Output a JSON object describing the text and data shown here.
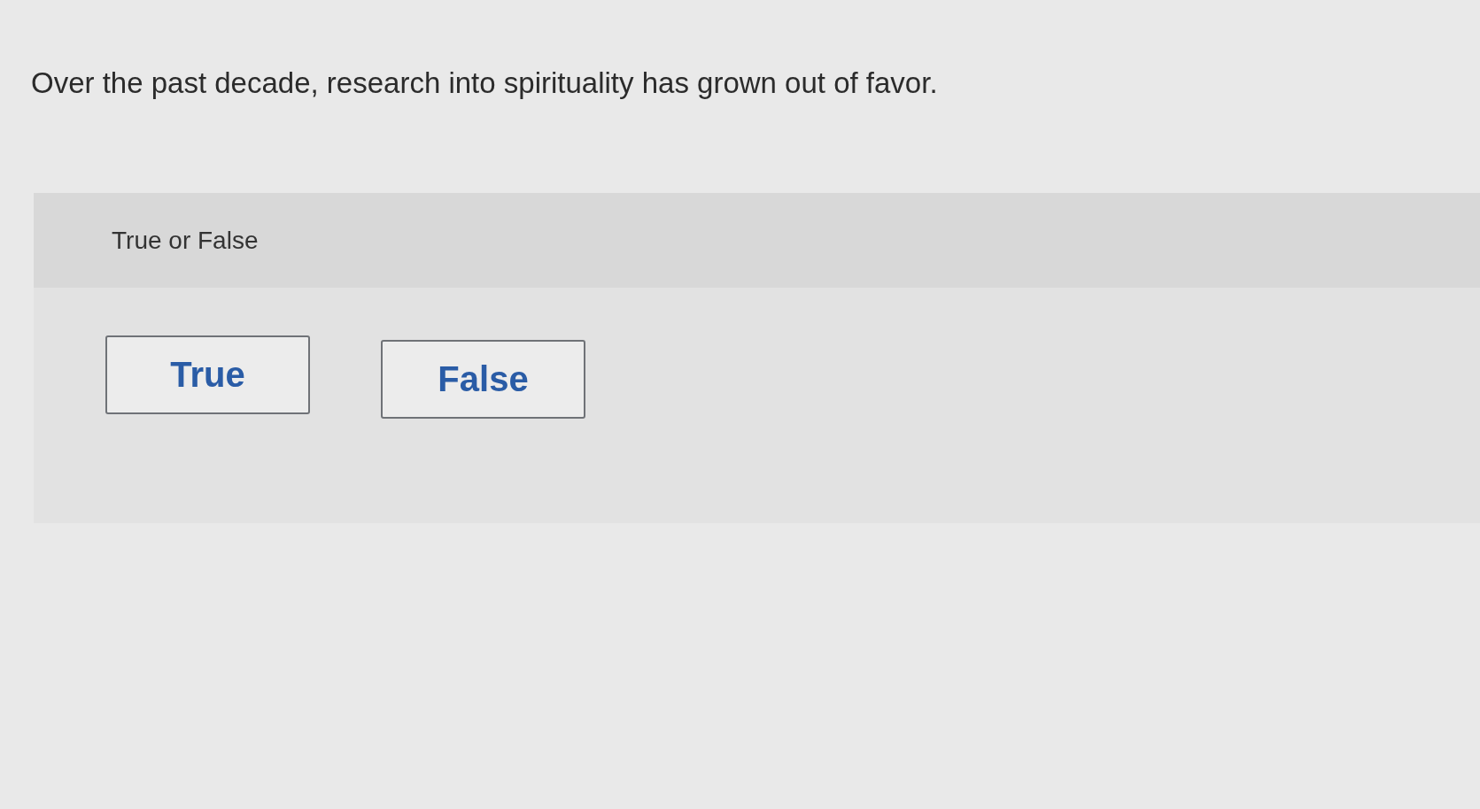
{
  "question": {
    "text": "Over the past decade, research into spirituality has grown out of favor."
  },
  "answer_panel": {
    "prompt": "True or False",
    "options": [
      {
        "label": "True",
        "selected": false
      },
      {
        "label": "False",
        "selected": false
      }
    ]
  }
}
